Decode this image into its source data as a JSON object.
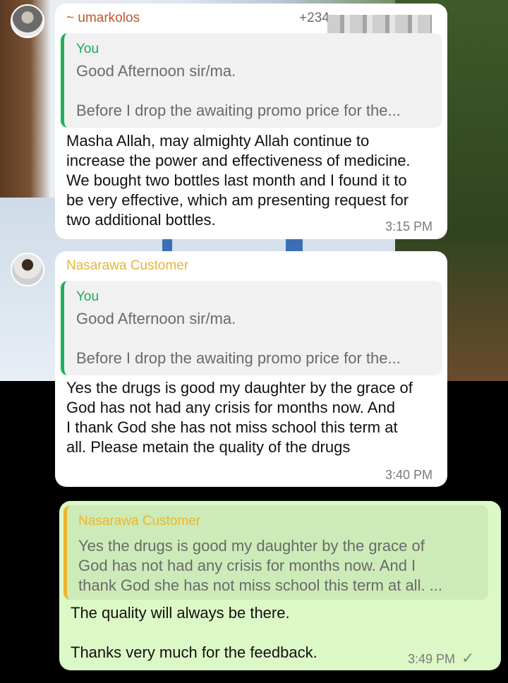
{
  "messages": [
    {
      "sender": "~ umarkolos",
      "phone_partial": "+234",
      "quote": {
        "author": "You",
        "text": "Good Afternoon sir/ma.\n\nBefore I drop the awaiting promo price for the..."
      },
      "text": "Masha Allah, may almighty Allah continue to\nincrease the power and effectiveness of medicine.\nWe bought two bottles last month and I found it to\nbe very effective, which am presenting request for\ntwo additional bottles.",
      "time": "3:15 PM"
    },
    {
      "sender": "Nasarawa Customer",
      "quote": {
        "author": "You",
        "text": "Good Afternoon sir/ma.\n\nBefore I drop the awaiting promo price for the..."
      },
      "text": "Yes the drugs is good my daughter by the grace of\nGod has not had any crisis for months now. And\nI thank God she has not miss school this term at\nall. Please metain the quality of the drugs",
      "time": "3:40 PM"
    },
    {
      "quote": {
        "author": "Nasarawa Customer",
        "text": "Yes the drugs is good my daughter by the grace of\nGod has not had any crisis for months now. And I\nthank God she has not miss school this term at all. ..."
      },
      "text": "The quality will always be there.\n\nThanks very much for the feedback.",
      "time": "3:49 PM"
    }
  ],
  "colors": {
    "sender1": "#c0582f",
    "sender2": "#e6b43a",
    "you": "#21a85a",
    "quote_author_out": "#f0b428",
    "outgoing_bubble": "#dcf8c6",
    "incoming_bubble": "#ffffff"
  },
  "icons": {
    "delivered": "check-icon"
  }
}
